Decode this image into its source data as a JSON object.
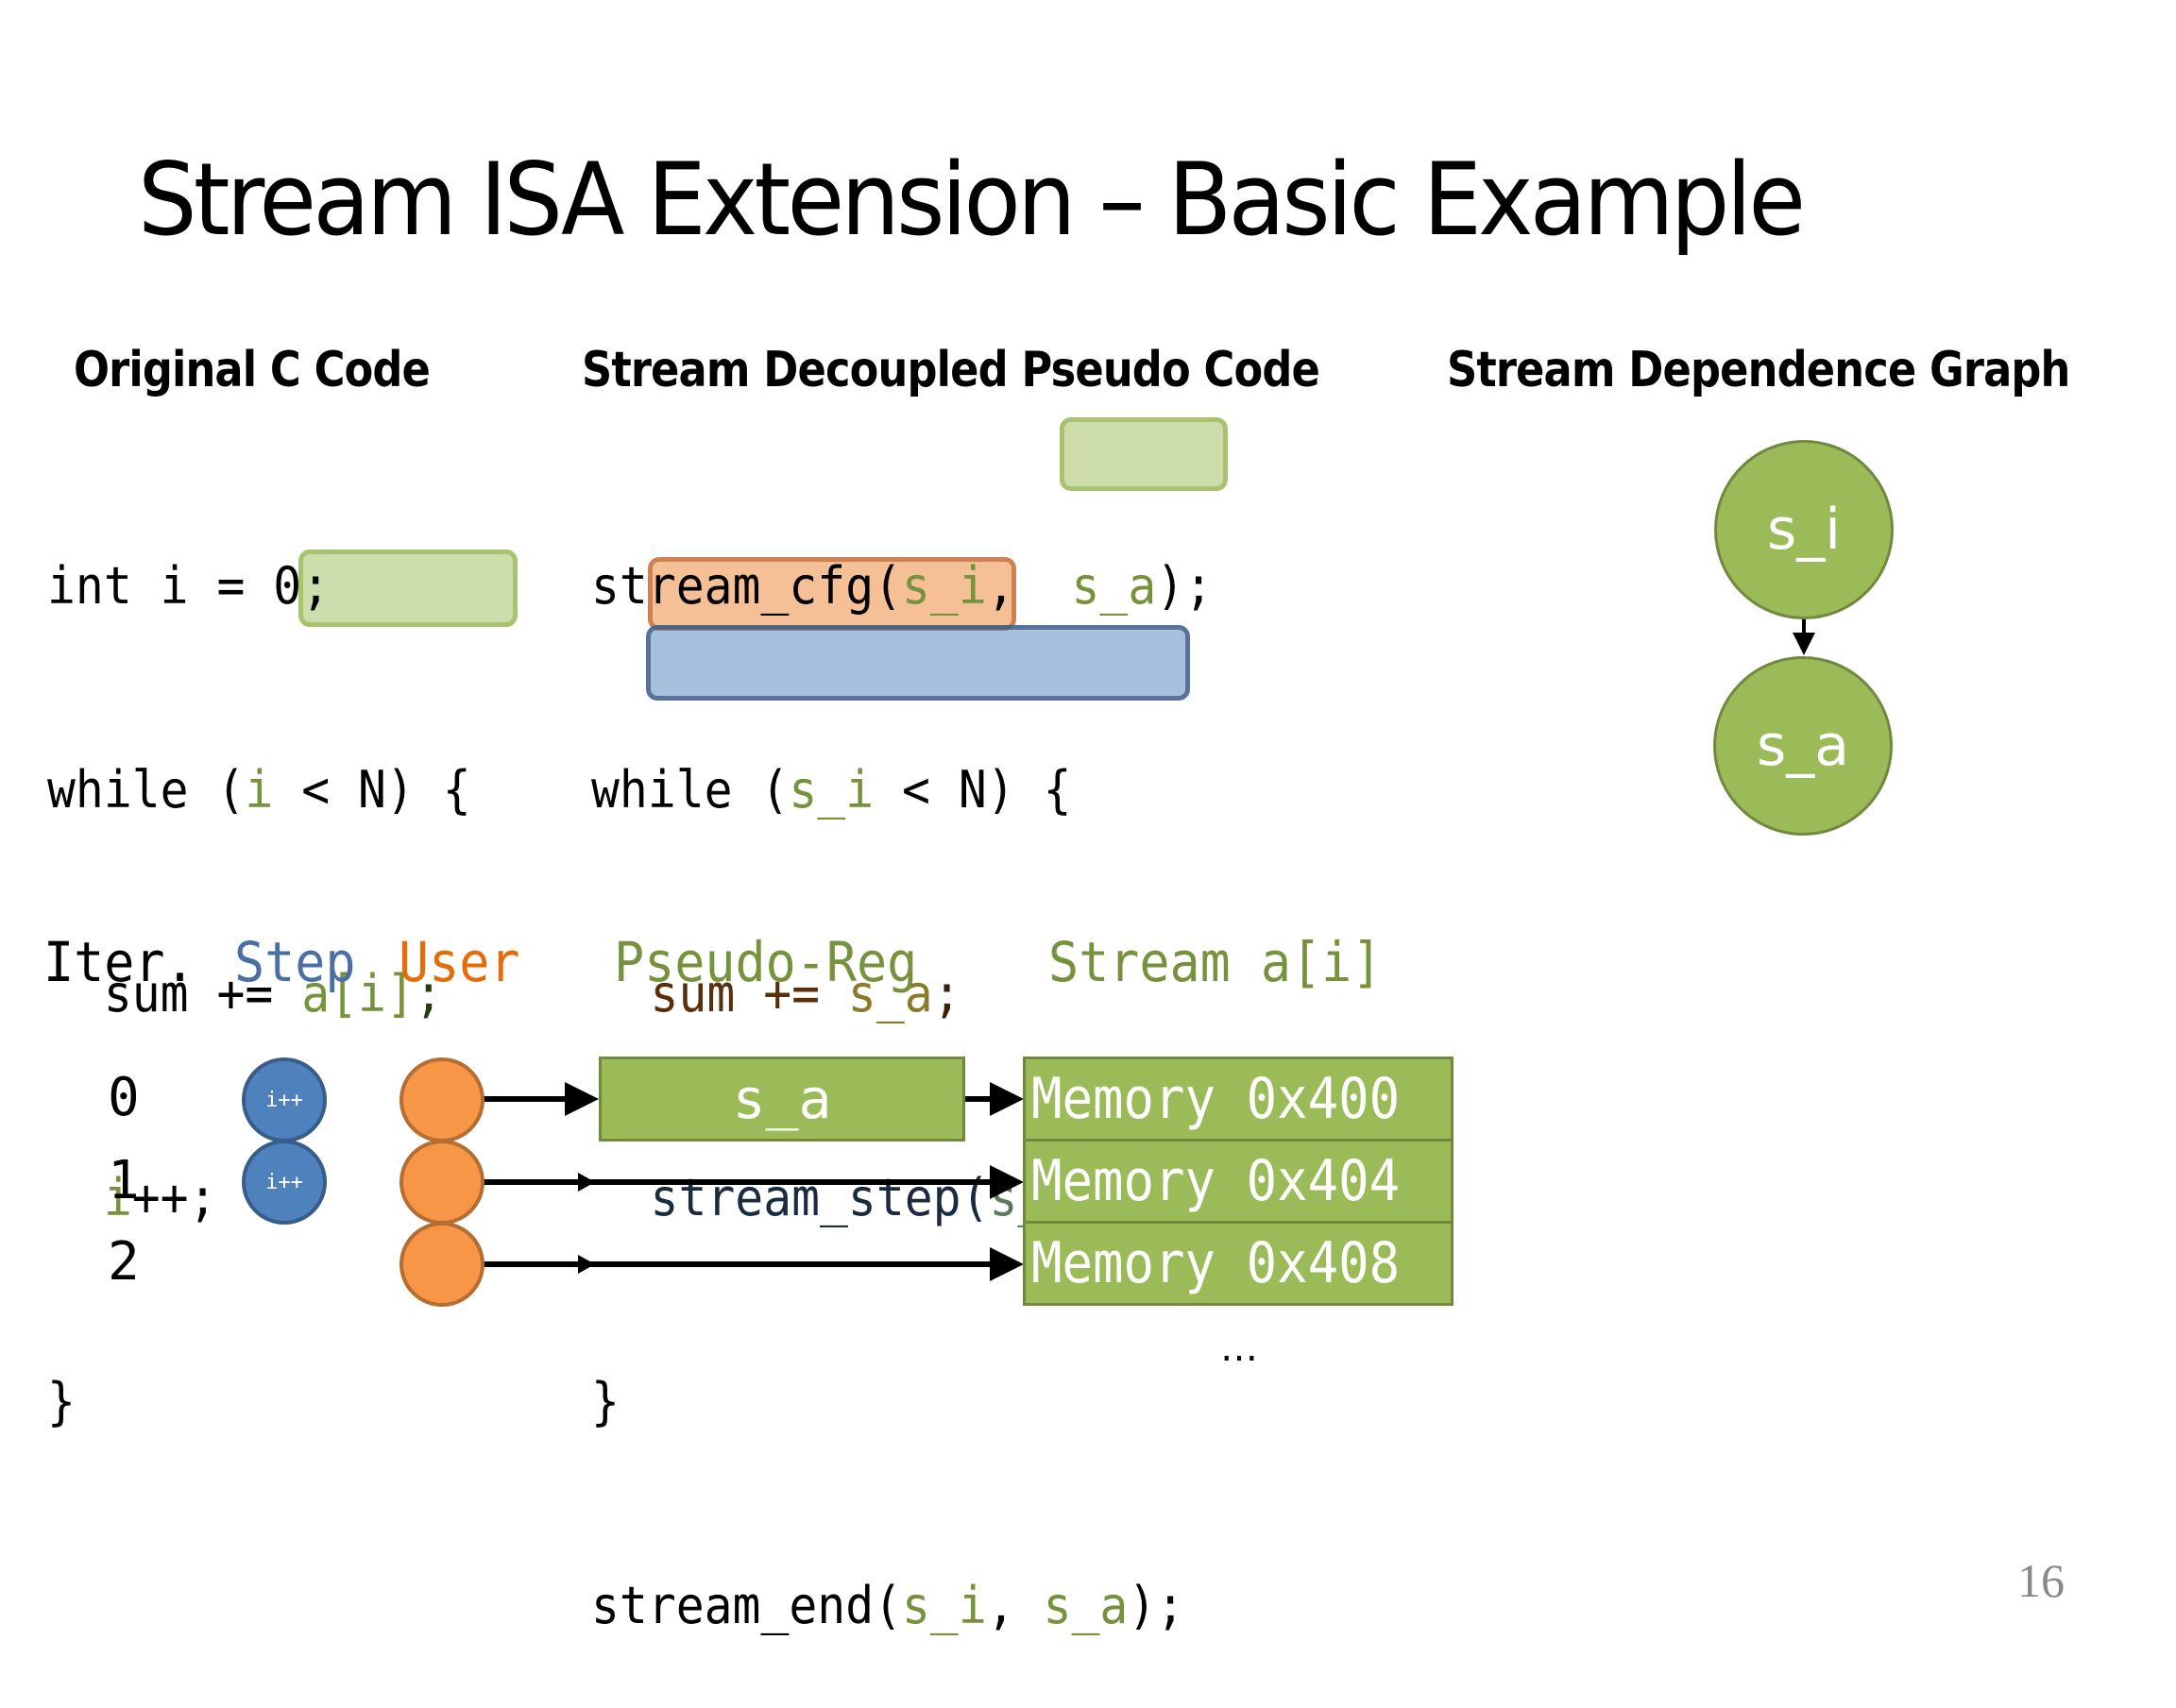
{
  "slide": {
    "title": "Stream ISA Extension – Basic Example",
    "page_number": "16"
  },
  "sections": {
    "original": "Original C Code",
    "pseudo": "Stream Decoupled Pseudo Code",
    "graph": "Stream Dependence Graph"
  },
  "original_code": {
    "l1": "int i = 0;",
    "l2_a": "while (",
    "l2_b": "i",
    "l2_c": " < N) {",
    "l3_a": "  sum +=",
    "l3_b": " a[i]",
    "l3_c": ";",
    "l4_a": "  ",
    "l4_b": "i",
    "l4_c": "++;",
    "l5": "}"
  },
  "pseudo_code": {
    "l1_a": "stream_cfg(",
    "l1_b": "s_i",
    "l1_c": ", ",
    "l1_d": " s_a",
    "l1_e": ");",
    "l2_a": "while (",
    "l2_b": "s_i",
    "l2_c": " < N) {",
    "l3_a": "sum += ",
    "l3_b": "s_a",
    "l3_c": ";",
    "l4_a": "stream_step(",
    "l4_b": "s_i",
    "l4_c": ");",
    "l5": "}",
    "l6_a": "stream_end(",
    "l6_b": "s_i",
    "l6_c": ", ",
    "l6_d": "s_a",
    "l6_e": ");"
  },
  "graph": {
    "nodes": [
      "s_i",
      "s_a"
    ],
    "edges": [
      [
        "s_i",
        "s_a"
      ]
    ]
  },
  "timeline": {
    "headers": {
      "iter": "Iter.",
      "step": "Step",
      "user": "User",
      "pseudo_reg": "Pseudo-Reg",
      "stream": "Stream a[i]"
    },
    "rows": [
      {
        "iter": "0",
        "step": "i++",
        "memory": "Memory 0x400"
      },
      {
        "iter": "1",
        "step": "i++",
        "memory": "Memory 0x404"
      },
      {
        "iter": "2",
        "step": "",
        "memory": "Memory 0x408"
      }
    ],
    "pseudo_reg_label": "s_a",
    "ellipsis": "…"
  },
  "colors": {
    "green": "#9bbb59",
    "green_text": "#76923c",
    "blue": "#4f81bd",
    "orange": "#f79646",
    "step_text": "#4a6fa5",
    "user_text": "#e46c0a"
  }
}
